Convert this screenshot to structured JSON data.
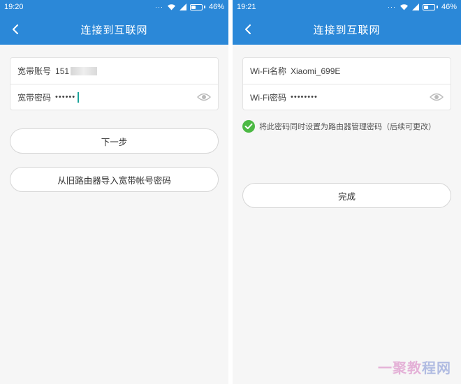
{
  "colors": {
    "primary": "#2b88d8",
    "check": "#4cb944",
    "cursor": "#1aa39a"
  },
  "left": {
    "status": {
      "time": "19:20",
      "battery": "46%"
    },
    "nav": {
      "title": "连接到互联网",
      "back_icon": "chevron-left-icon"
    },
    "fields": {
      "account_label": "宽带账号",
      "account_value": "151",
      "password_label": "宽带密码",
      "password_value": "••••••"
    },
    "buttons": {
      "next": "下一步",
      "import": "从旧路由器导入宽带帐号密码"
    }
  },
  "right": {
    "status": {
      "time": "19:21",
      "battery": "46%"
    },
    "nav": {
      "title": "连接到互联网",
      "back_icon": "chevron-left-icon"
    },
    "fields": {
      "wifi_name_label": "Wi-Fi名称",
      "wifi_name_value": "Xiaomi_699E",
      "wifi_password_label": "Wi-Fi密码",
      "wifi_password_value": "••••••••"
    },
    "checkbox": {
      "label": "将此密码同时设置为路由器管理密码（后续可更改）",
      "checked": true
    },
    "buttons": {
      "done": "完成"
    }
  },
  "watermark": {
    "text_main": "一聚教",
    "text_accent": "程网"
  },
  "battery_level": 0.46
}
